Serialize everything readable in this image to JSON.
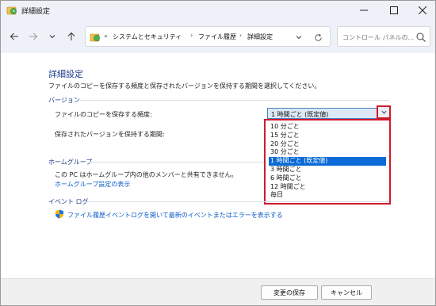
{
  "window": {
    "title": "詳細設定"
  },
  "navbar": {
    "breadcrumb_lead": "«",
    "breadcrumbs": [
      "システムとセキュリティ",
      "ファイル履歴",
      "詳細設定"
    ],
    "search_placeholder": "コントロール パネルの..."
  },
  "page": {
    "title": "詳細設定",
    "description": "ファイルのコピーを保存する頻度と保存されたバージョンを保持する期間を選択してください。"
  },
  "versions": {
    "heading": "バージョン",
    "save_frequency_label": "ファイルのコピーを保存する頻度:",
    "save_frequency_value": "1 時間ごと (既定値)",
    "retention_label": "保存されたバージョンを保持する期間:",
    "dropdown_options": [
      "10 分ごと",
      "15 分ごと",
      "20 分ごと",
      "30 分ごと",
      "1 時間ごと (既定値)",
      "3 時間ごと",
      "6 時間ごと",
      "12 時間ごと",
      "毎日"
    ],
    "selected_index": 4
  },
  "homegroup": {
    "heading": "ホームグループ",
    "text": "この PC はホームグループ内の他のメンバーと共有できません。",
    "link": "ホームグループ設定の表示"
  },
  "eventlog": {
    "heading": "イベント ログ",
    "link": "ファイル履歴イベントログを開いて最新のイベントまたはエラーを表示する"
  },
  "footer": {
    "save_label": "変更の保存",
    "cancel_label": "キャンセル"
  },
  "colors": {
    "accent": "#0a6ad6",
    "heading": "#1e3a8a",
    "link": "#0b5cc9",
    "highlight_border": "#d1192c"
  }
}
